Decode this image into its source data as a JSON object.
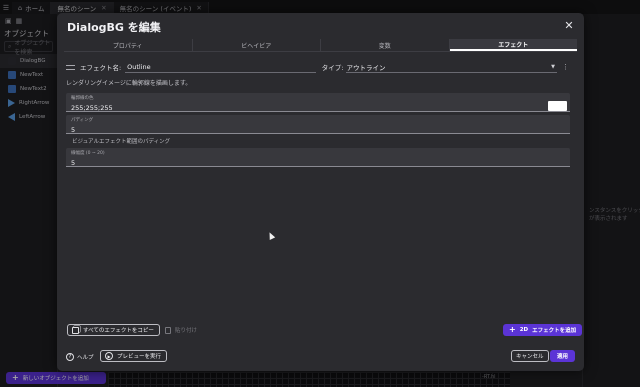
{
  "app": {
    "tabs": [
      {
        "label": "ホーム"
      },
      {
        "label": "無名のシーン"
      },
      {
        "label": "無名のシーン (イベント)"
      }
    ],
    "left_panel": {
      "title": "オブジェクト",
      "search_placeholder": "オブジェクトを検索",
      "items": [
        {
          "label": "DialogBG"
        },
        {
          "label": "NewText"
        },
        {
          "label": "NewText2"
        },
        {
          "label": "RightArrow"
        },
        {
          "label": "LeftArrow"
        }
      ],
      "add_button": "新しいオブジェクトを追加"
    },
    "right_panel": {
      "hint_line1": "ンスタンスをクリック",
      "hint_line2": "が表示されます"
    },
    "canvas_label": "-RT.hl"
  },
  "dialog": {
    "title": "DialogBG を編集",
    "tabs": [
      {
        "label": "プロパティ"
      },
      {
        "label": "ビヘイビア"
      },
      {
        "label": "変数"
      },
      {
        "label": "エフェクト"
      }
    ],
    "active_tab": "エフェクト",
    "effect": {
      "name_label": "エフェクト名:",
      "name_value": "Outline",
      "type_label": "タイプ:",
      "type_value": "アウトライン",
      "description": "レンダリングイメージに輪郭線を描画します。",
      "fields": [
        {
          "label": "輪郭線の色",
          "value": "255;255;255",
          "swatch_color": "#ffffff"
        },
        {
          "label": "パディング",
          "value": "5"
        }
      ],
      "section_label": "ビジュアルエフェクト範囲のパディング",
      "thickness": {
        "label": "線幅度 (0 ~ 20)",
        "value": "5"
      }
    },
    "footer": {
      "copy_all_button": "すべてのエフェクトをコピー",
      "paste_button": "貼り付け",
      "add_effect_button": "エフェクトを追加",
      "add_effect_prefix": "2D",
      "help_button": "ヘルプ",
      "preview_button": "プレビューを実行",
      "cancel_button": "キャンセル",
      "apply_button": "適用"
    }
  },
  "colors": {
    "accent": "#5b34d6",
    "dialog_bg": "#2b2b2f",
    "field_bg": "#38383d"
  }
}
